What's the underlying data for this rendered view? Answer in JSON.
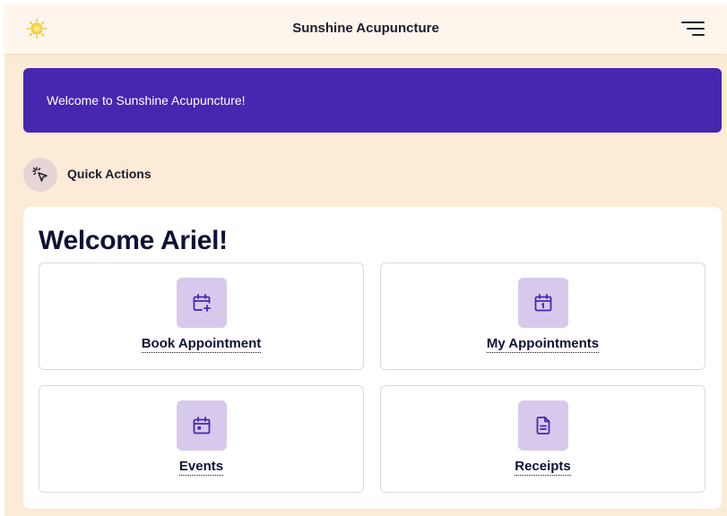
{
  "header": {
    "title": "Sunshine Acupuncture",
    "logo_icon": "sun-icon",
    "menu_icon": "menu-icon"
  },
  "banner": {
    "text": "Welcome to Sunshine Acupuncture!",
    "color": "#4726b0"
  },
  "quick_actions": {
    "icon": "sparkle-cursor-icon",
    "label": "Quick Actions"
  },
  "main": {
    "welcome": "Welcome Ariel!",
    "cards": [
      {
        "label": "Book Appointment",
        "icon": "calendar-plus-icon"
      },
      {
        "label": "My Appointments",
        "icon": "calendar-day-icon"
      },
      {
        "label": "Events",
        "icon": "calendar-event-icon"
      },
      {
        "label": "Receipts",
        "icon": "document-icon"
      }
    ]
  },
  "colors": {
    "background": "#fcebd6",
    "topbar": "#fef6ec",
    "tile": "#d6c9ec",
    "icon": "#4726b0"
  }
}
